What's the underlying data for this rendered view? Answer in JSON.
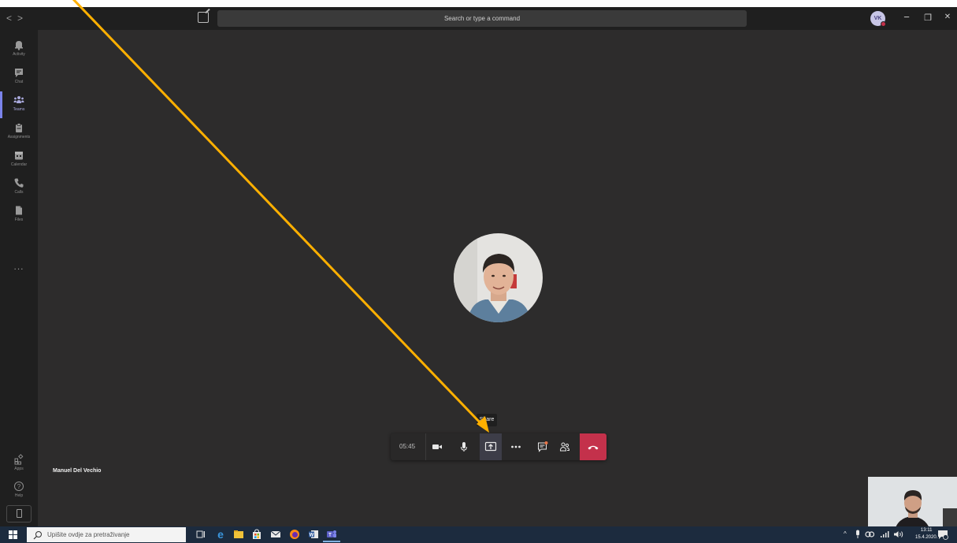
{
  "titlebar": {
    "back_label": "<",
    "forward_label": ">",
    "search_placeholder": "Search or type a command",
    "user_initials": "VK",
    "minimize_label": "−",
    "restore_label": "❐",
    "close_label": "✕"
  },
  "rail": {
    "items": [
      {
        "label": "Activity",
        "icon": "bell-icon"
      },
      {
        "label": "Chat",
        "icon": "chat-icon"
      },
      {
        "label": "Teams",
        "icon": "teams-icon",
        "active": true
      },
      {
        "label": "Assignments",
        "icon": "assignments-icon"
      },
      {
        "label": "Calendar",
        "icon": "calendar-icon"
      },
      {
        "label": "Calls",
        "icon": "phone-icon"
      },
      {
        "label": "Files",
        "icon": "file-icon"
      }
    ],
    "more_label": "...",
    "apps_label": "Apps",
    "help_label": "Help"
  },
  "call": {
    "participant_name": "Manuel Del Vechio",
    "timer": "05:45",
    "share_tooltip": "Share",
    "controls": [
      "camera-icon",
      "microphone-icon",
      "share-icon",
      "more-icon",
      "chat-icon",
      "participants-icon",
      "hang-up-icon"
    ]
  },
  "taskbar": {
    "search_placeholder": "Upišite ovdje za pretraživanje",
    "time": "13:11",
    "date": "15.4.2020.",
    "tray_label": "^"
  },
  "colors": {
    "accent": "#7b83eb",
    "hangup": "#c4314b",
    "annotation_arrow": "#ffb000",
    "stage": "#2d2c2c",
    "taskbar": "#1c2b3e"
  }
}
